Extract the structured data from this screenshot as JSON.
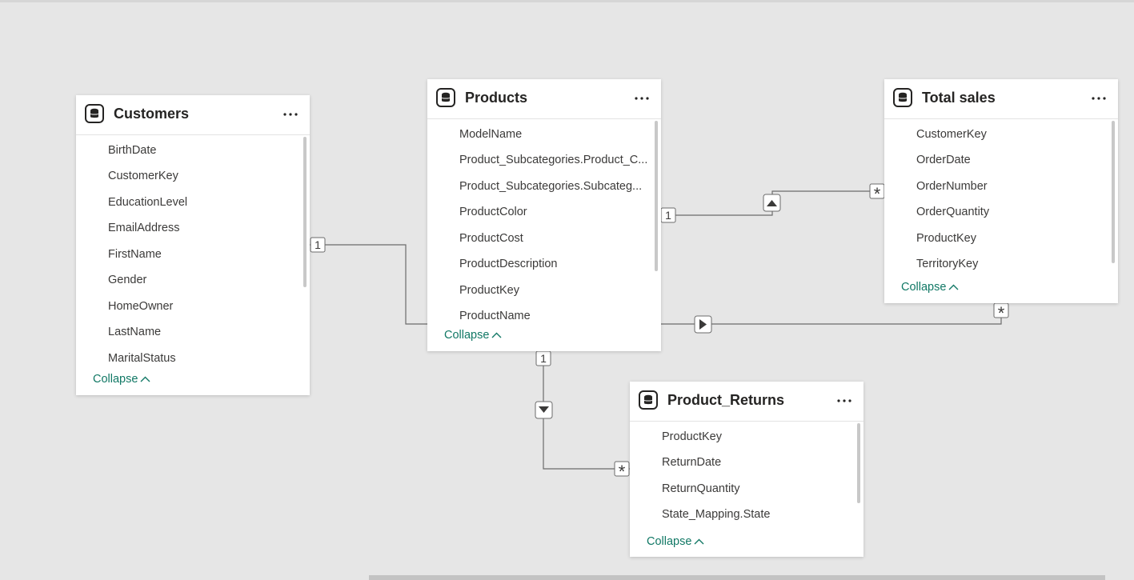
{
  "tables": {
    "customers": {
      "title": "Customers",
      "fields": [
        "BirthDate",
        "CustomerKey",
        "EducationLevel",
        "EmailAddress",
        "FirstName",
        "Gender",
        "HomeOwner",
        "LastName",
        "MaritalStatus"
      ]
    },
    "products": {
      "title": "Products",
      "fields": [
        "ModelName",
        "Product_Subcategories.Product_C...",
        "Product_Subcategories.Subcateg...",
        "ProductColor",
        "ProductCost",
        "ProductDescription",
        "ProductKey",
        "ProductName"
      ]
    },
    "total_sales": {
      "title": "Total sales",
      "fields": [
        "CustomerKey",
        "OrderDate",
        "OrderNumber",
        "OrderQuantity",
        "ProductKey",
        "TerritoryKey"
      ]
    },
    "product_returns": {
      "title": "Product_Returns",
      "fields": [
        "ProductKey",
        "ReturnDate",
        "ReturnQuantity",
        "State_Mapping.State"
      ]
    }
  },
  "collapse_label": "Collapse",
  "cardinality": {
    "one": "1",
    "many": "*"
  },
  "icons": {
    "table": "database-icon",
    "more": "ellipsis-icon",
    "collapse": "chevron-up-icon",
    "filter_direction": "triangle-arrow-icon"
  },
  "colors": {
    "canvas": "#e6e6e6",
    "link": "#117865",
    "line": "#6b6b6b"
  }
}
